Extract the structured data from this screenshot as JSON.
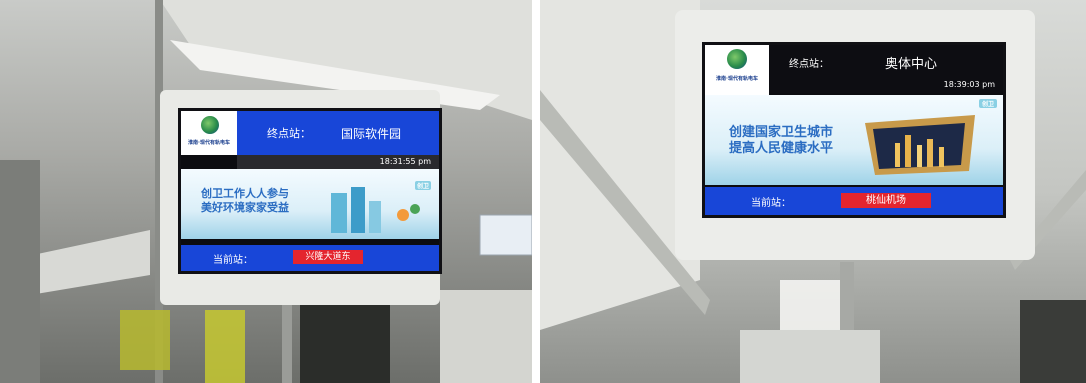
{
  "left_display": {
    "logo_text": "淮南·现代有轨电车",
    "terminal_label": "终点站：",
    "terminal_station": "国际软件园",
    "time": "18:31:55 pm",
    "ad_lines": [
      "创卫工作人人参与",
      "美好环境家家受益"
    ],
    "ad_badge": "创卫",
    "current_label": "当前站：",
    "current_station": "兴隆大道东"
  },
  "right_display": {
    "logo_text": "淮南·现代有轨电车",
    "terminal_label": "终点站：",
    "terminal_station": "奥体中心",
    "time": "18:39:03 pm",
    "ad_lines": [
      "创建国家卫生城市",
      "提高人民健康水平"
    ],
    "ad_badge": "创卫",
    "current_label": "当前站：",
    "current_station": "桃仙机场"
  },
  "colors": {
    "screen_blue": "#1846d8",
    "station_red": "#e4252e",
    "ad_text_blue": "#2b6dc2"
  }
}
